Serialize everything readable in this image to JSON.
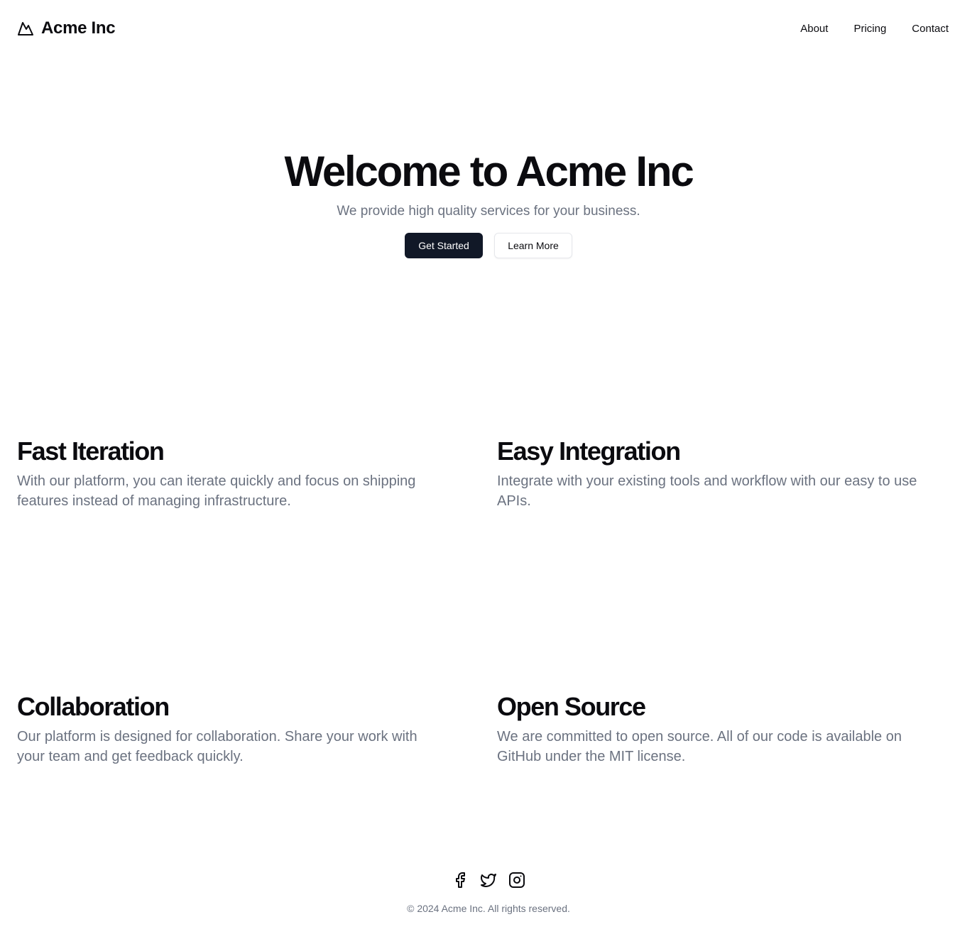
{
  "header": {
    "brand_name": "Acme Inc",
    "brand_icon": "mountain-icon",
    "nav": [
      {
        "label": "About"
      },
      {
        "label": "Pricing"
      },
      {
        "label": "Contact"
      }
    ]
  },
  "hero": {
    "title": "Welcome to Acme Inc",
    "subtitle": "We provide high quality services for your business.",
    "primary_cta": "Get Started",
    "secondary_cta": "Learn More"
  },
  "features": [
    {
      "title": "Fast Iteration",
      "description": "With our platform, you can iterate quickly and focus on shipping features instead of managing infrastructure."
    },
    {
      "title": "Easy Integration",
      "description": "Integrate with your existing tools and workflow with our easy to use APIs."
    },
    {
      "title": "Collaboration",
      "description": "Our platform is designed for collaboration. Share your work with your team and get feedback quickly."
    },
    {
      "title": "Open Source",
      "description": "We are committed to open source. All of our code is available on GitHub under the MIT license."
    }
  ],
  "footer": {
    "social_icons": [
      "facebook-icon",
      "twitter-icon",
      "instagram-icon"
    ],
    "copyright": "© 2024 Acme Inc. All rights reserved."
  },
  "colors": {
    "text": "#0b0b0f",
    "muted": "#6b7280",
    "primary_button": "#111827",
    "border": "#e5e7eb"
  }
}
